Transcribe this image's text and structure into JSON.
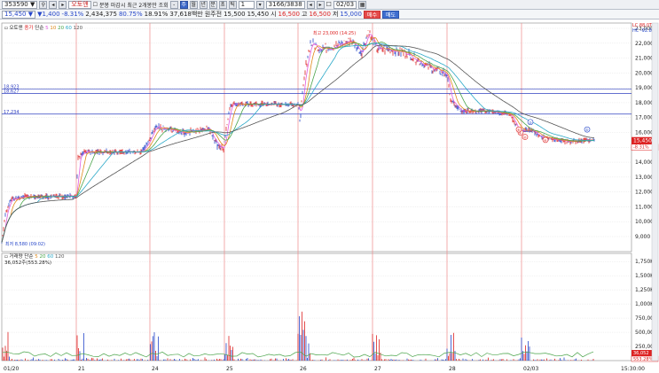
{
  "toolbar": {
    "code": "353590",
    "symbol": "오토앤",
    "buttons": [
      "주",
      "월",
      "년",
      "분",
      "초",
      "틱"
    ],
    "interval": "1",
    "count": "3166/3838",
    "date": "02/03",
    "check_label": "분봉 마감시 최근 2개봉만 조회"
  },
  "quote": {
    "price": "15,450",
    "change": "1,400",
    "change_pct": "-8.31%",
    "volume": "2,434,375",
    "vol_ratio": "80.75%",
    "strength": "18.91%",
    "amount_label": "37,618백만",
    "investor": "원주전",
    "open": "15,500",
    "open2": "15,450",
    "open_label": "시",
    "high": "16,500",
    "high_label": "고",
    "low": "16,500",
    "low_label": "저",
    "close": "15,000",
    "buy": "매수",
    "sell": "매도"
  },
  "price_panel": {
    "legend": [
      "오토앤",
      "종가",
      "단순",
      "5",
      "10",
      "20",
      "60",
      "120"
    ],
    "max_label": "최고 23,000 (14:25)",
    "min_label": "최저 8,580 (09:02)",
    "hlines": [
      "18,923",
      "18,627",
      "17,234"
    ],
    "right_top": [
      "LC 88.0T",
      "HC -92.83"
    ],
    "current": "15,450",
    "current_pct": "-8.31%",
    "axis": [
      "23,000",
      "22,000",
      "21,000",
      "20,000",
      "19,000",
      "18,000",
      "17,000",
      "16,000",
      "15,000",
      "14,000",
      "13,000",
      "12,000",
      "11,000",
      "10,000",
      "9,000"
    ],
    "markers": [
      "①",
      "②",
      "③",
      "④",
      "⑤",
      "⑥"
    ]
  },
  "volume_panel": {
    "legend": [
      "거래량",
      "단순",
      "5",
      "20",
      "60",
      "120"
    ],
    "sub": "36,052주(553.28%)",
    "axis": [
      "1,750K",
      "1,500K",
      "1,250K",
      "1,000K",
      "750,000",
      "500,000",
      "250,000"
    ],
    "current": "36,052",
    "current_pct": "553.28%"
  },
  "x_axis": {
    "labels": [
      "01/20",
      "21",
      "24",
      "25",
      "26",
      "27",
      "28",
      "02/03"
    ],
    "right": "15:30:00"
  },
  "colors": {
    "up": "#d22",
    "down": "#2546c9",
    "ma5": "#e08a1a",
    "ma20": "#4aa44a"
  },
  "chart_data": {
    "type": "line",
    "title": "",
    "x": [
      "01/20",
      "21",
      "24",
      "25",
      "26",
      "27",
      "28",
      "02/03"
    ],
    "series": [
      {
        "name": "price",
        "values": [
          8580,
          14600,
          15300,
          18400,
          22500,
          21000,
          17500,
          15450
        ]
      }
    ],
    "y_range": [
      8580,
      23000
    ],
    "max": 23000,
    "min": 8580
  }
}
